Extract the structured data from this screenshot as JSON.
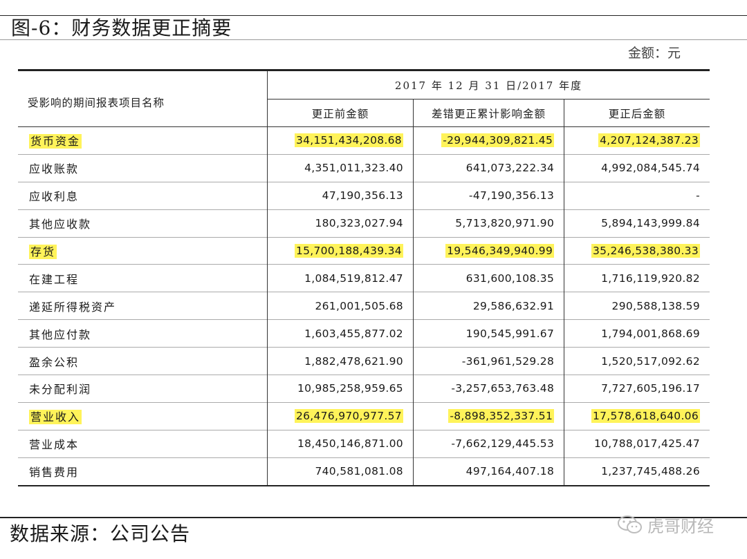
{
  "figure": {
    "title": "图-6：财务数据更正摘要",
    "unit": "金额：元"
  },
  "table": {
    "row_header": "受影响的期间报表项目名称",
    "period_header": "2017 年 12 月 31 日/2017 年度",
    "columns": [
      "更正前金额",
      "差错更正累计影响金额",
      "更正后金额"
    ],
    "rows": [
      {
        "name": "货币资金",
        "before": "34,151,434,208.68",
        "impact": "-29,944,309,821.45",
        "after": "4,207,124,387.23",
        "highlight": true
      },
      {
        "name": "应收账款",
        "before": "4,351,011,323.40",
        "impact": "641,073,222.34",
        "after": "4,992,084,545.74",
        "highlight": false
      },
      {
        "name": "应收利息",
        "before": "47,190,356.13",
        "impact": "-47,190,356.13",
        "after": "-",
        "highlight": false
      },
      {
        "name": "其他应收款",
        "before": "180,323,027.94",
        "impact": "5,713,820,971.90",
        "after": "5,894,143,999.84",
        "highlight": false
      },
      {
        "name": "存货",
        "before": "15,700,188,439.34",
        "impact": "19,546,349,940.99",
        "after": "35,246,538,380.33",
        "highlight": true
      },
      {
        "name": "在建工程",
        "before": "1,084,519,812.47",
        "impact": "631,600,108.35",
        "after": "1,716,119,920.82",
        "highlight": false
      },
      {
        "name": "递延所得税资产",
        "before": "261,001,505.68",
        "impact": "29,586,632.91",
        "after": "290,588,138.59",
        "highlight": false
      },
      {
        "name": "其他应付款",
        "before": "1,603,455,877.02",
        "impact": "190,545,991.67",
        "after": "1,794,001,868.69",
        "highlight": false
      },
      {
        "name": "盈余公积",
        "before": "1,882,478,621.90",
        "impact": "-361,961,529.28",
        "after": "1,520,517,092.62",
        "highlight": false
      },
      {
        "name": "未分配利润",
        "before": "10,985,258,959.65",
        "impact": "-3,257,653,763.48",
        "after": "7,727,605,196.17",
        "highlight": false
      },
      {
        "name": "营业收入",
        "before": "26,476,970,977.57",
        "impact": "-8,898,352,337.51",
        "after": "17,578,618,640.06",
        "highlight": true
      },
      {
        "name": "营业成本",
        "before": "18,450,146,871.00",
        "impact": "-7,662,129,445.53",
        "after": "10,788,017,425.47",
        "highlight": false
      },
      {
        "name": "销售费用",
        "before": "740,581,081.08",
        "impact": "497,164,407.18",
        "after": "1,237,745,488.26",
        "highlight": false
      }
    ]
  },
  "footer": {
    "source": "数据来源：公司公告",
    "watermark": "虎哥财经",
    "watermark_icon": "wechat-icon"
  },
  "colors": {
    "highlight": "#fff35a"
  }
}
